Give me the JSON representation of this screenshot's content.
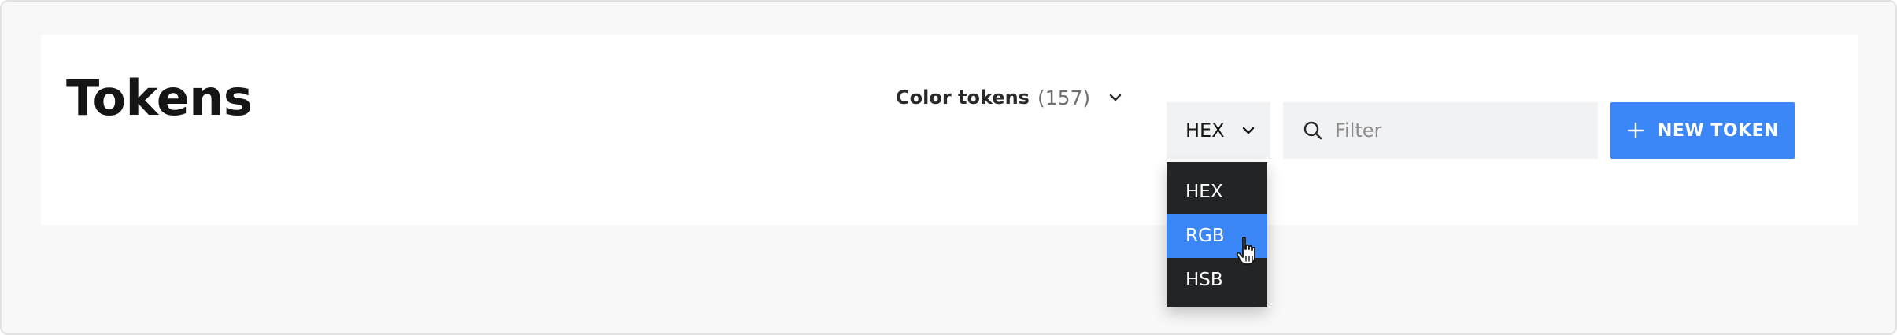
{
  "header": {
    "title": "Tokens"
  },
  "token_type": {
    "label": "Color tokens",
    "count": "(157)",
    "icon": "chevron-down-icon"
  },
  "format_select": {
    "value": "HEX",
    "icon": "chevron-down-icon",
    "options": [
      {
        "label": "HEX",
        "selected": false
      },
      {
        "label": "RGB",
        "selected": true
      },
      {
        "label": "HSB",
        "selected": false
      }
    ]
  },
  "filter": {
    "placeholder": "Filter",
    "value": "",
    "icon": "search-icon"
  },
  "new_token": {
    "label": "NEW TOKEN",
    "icon": "plus-icon"
  },
  "colors": {
    "accent": "#3b87f7",
    "dropdown_bg": "#232426",
    "input_bg": "#f1f2f3",
    "page_bg": "#f8f8f8",
    "title_text": "#151515"
  }
}
